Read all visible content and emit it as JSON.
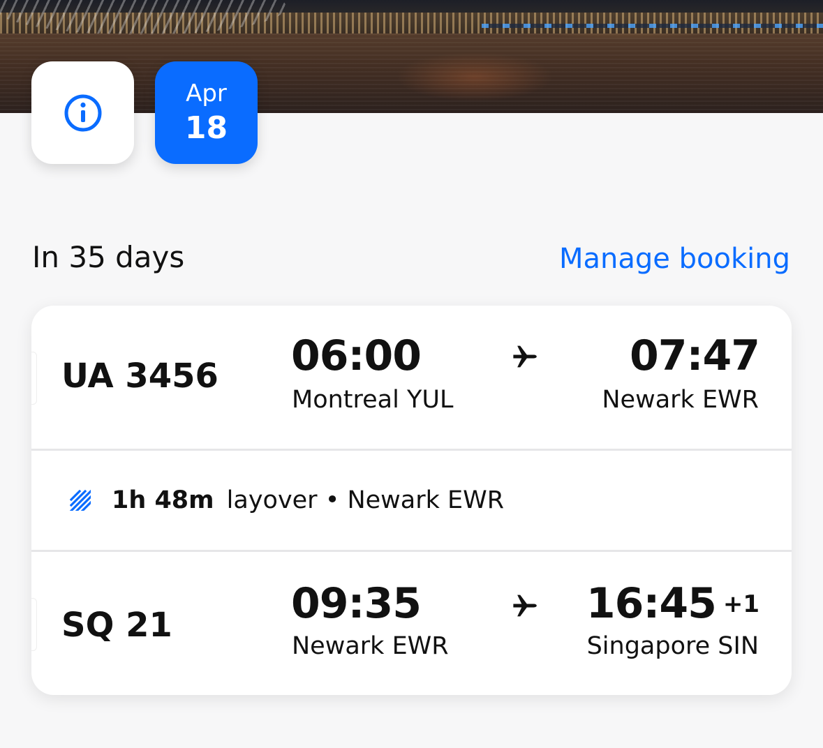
{
  "header": {
    "info_icon": "info-icon",
    "date": {
      "month": "Apr",
      "day": "18"
    }
  },
  "trip": {
    "countdown": "In 35 days",
    "manage_label": "Manage booking"
  },
  "segments": [
    {
      "flight": "UA 3456",
      "dep_time": "06:00",
      "dep_place": "Montreal YUL",
      "arr_time": "07:47",
      "arr_place": "Newark EWR",
      "day_offset": ""
    },
    {
      "flight": "SQ 21",
      "dep_time": "09:35",
      "dep_place": "Newark EWR",
      "arr_time": "16:45",
      "arr_place": "Singapore SIN",
      "day_offset": "+1"
    }
  ],
  "layover": {
    "duration": "1h 48m",
    "label": "layover • Newark EWR"
  },
  "colors": {
    "accent": "#0a6cff",
    "background": "#f7f7f8",
    "card": "#ffffff",
    "text": "#111111"
  }
}
